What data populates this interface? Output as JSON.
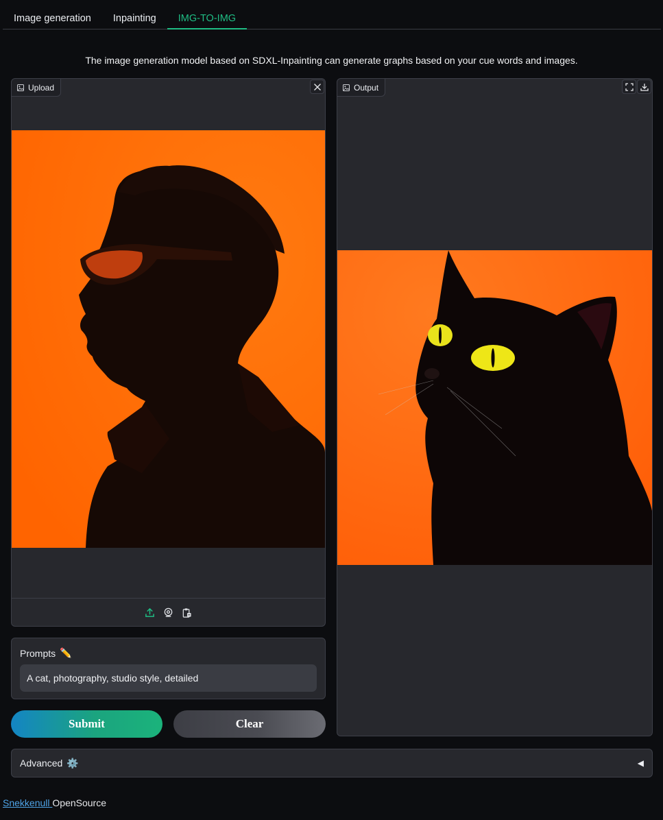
{
  "tabs": [
    {
      "label": "Image generation",
      "active": false
    },
    {
      "label": "Inpainting",
      "active": false
    },
    {
      "label": "IMG-TO-IMG",
      "active": true
    }
  ],
  "description": "The image generation model based on SDXL-Inpainting can generate graphs based on your cue words and images.",
  "upload": {
    "label": "Upload",
    "icons": [
      "image-icon",
      "close-icon",
      "upload-icon",
      "webcam-icon",
      "clipboard-icon"
    ]
  },
  "output": {
    "label": "Output",
    "icons": [
      "image-icon",
      "fullscreen-icon",
      "download-icon"
    ]
  },
  "prompt": {
    "label": "Prompts",
    "emoji": "✏️",
    "value": "A cat, photography, studio style, detailed"
  },
  "buttons": {
    "submit": "Submit",
    "clear": "Clear"
  },
  "advanced": {
    "label": "Advanced",
    "emoji": "⚙️",
    "arrow": "◀"
  },
  "footer": {
    "link": "Snekkenull ",
    "text": "OpenSource"
  },
  "colors": {
    "accent": "#1fbd84",
    "panel_bg": "#27282d",
    "page_bg": "#0c0d10",
    "image_bg": "#ff6a00"
  }
}
